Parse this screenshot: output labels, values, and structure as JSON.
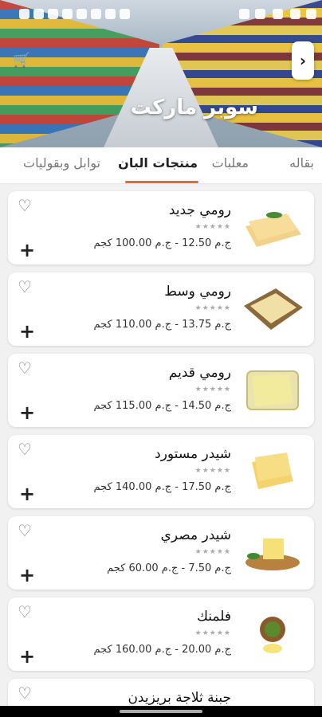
{
  "store": {
    "title": "سوبر ماركت",
    "next_icon": "chevron-right-icon",
    "cart_icon": "cart-icon"
  },
  "tabs": [
    {
      "label": "بقاله"
    },
    {
      "label": "معلبات"
    },
    {
      "label": "منتجات البان"
    },
    {
      "label": "توابل وبقوليات"
    }
  ],
  "active_tab": "منتجات البان",
  "stars_text": "★★★★★",
  "products": [
    {
      "name": "رومي جديد",
      "price_range": "ج.م 12.50 - ج.م 100.00",
      "unit": "كجم"
    },
    {
      "name": "رومي وسط",
      "price_range": "ج.م 13.75 - ج.م 110.00",
      "unit": "كجم"
    },
    {
      "name": "رومي قديم",
      "price_range": "ج.م 14.50 - ج.م 115.00",
      "unit": "كجم"
    },
    {
      "name": "شيدر مستورد",
      "price_range": "ج.م 17.50 - ج.م 140.00",
      "unit": "كجم"
    },
    {
      "name": "شيدر مصري",
      "price_range": "ج.م 7.50 - ج.م 60.00",
      "unit": "كجم"
    },
    {
      "name": "فلمنك",
      "price_range": "ج.م 20.00 - ج.م 160.00",
      "unit": "كجم"
    },
    {
      "name": "جبنة ثلاجة بريزيدن",
      "price_range": "",
      "unit": ""
    }
  ],
  "colors": {
    "accent": "#e46a3a"
  }
}
